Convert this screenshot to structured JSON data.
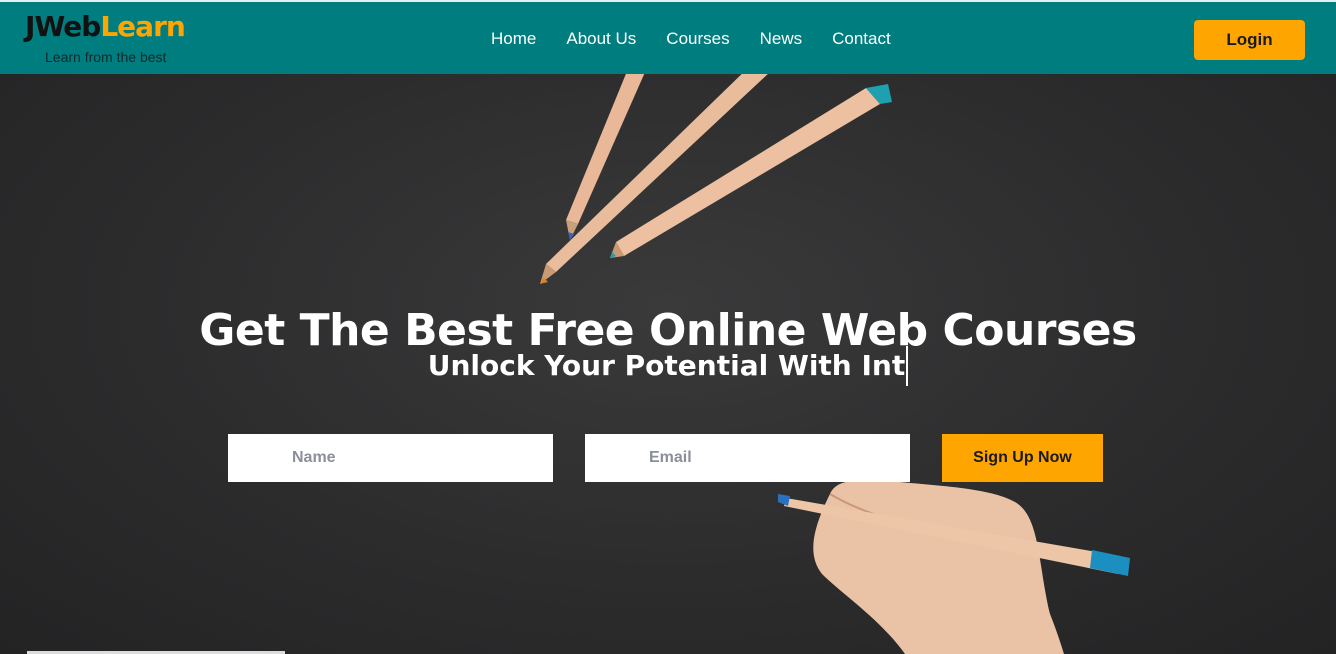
{
  "brand": {
    "name_part1": "JWeb",
    "name_part2": "Learn",
    "tagline": "Learn from the best"
  },
  "nav": {
    "items": [
      "Home",
      "About Us",
      "Courses",
      "News",
      "Contact"
    ]
  },
  "header": {
    "login_label": "Login"
  },
  "hero": {
    "title": "Get The Best Free Online Web Courses",
    "subtitle": "Unlock Your Potential With Int"
  },
  "form": {
    "name_placeholder": "Name",
    "email_placeholder": "Email",
    "signup_label": "Sign Up Now"
  },
  "colors": {
    "header_bg": "#007d7f",
    "accent": "#ffa500",
    "hero_bg": "#2a2a2b"
  }
}
